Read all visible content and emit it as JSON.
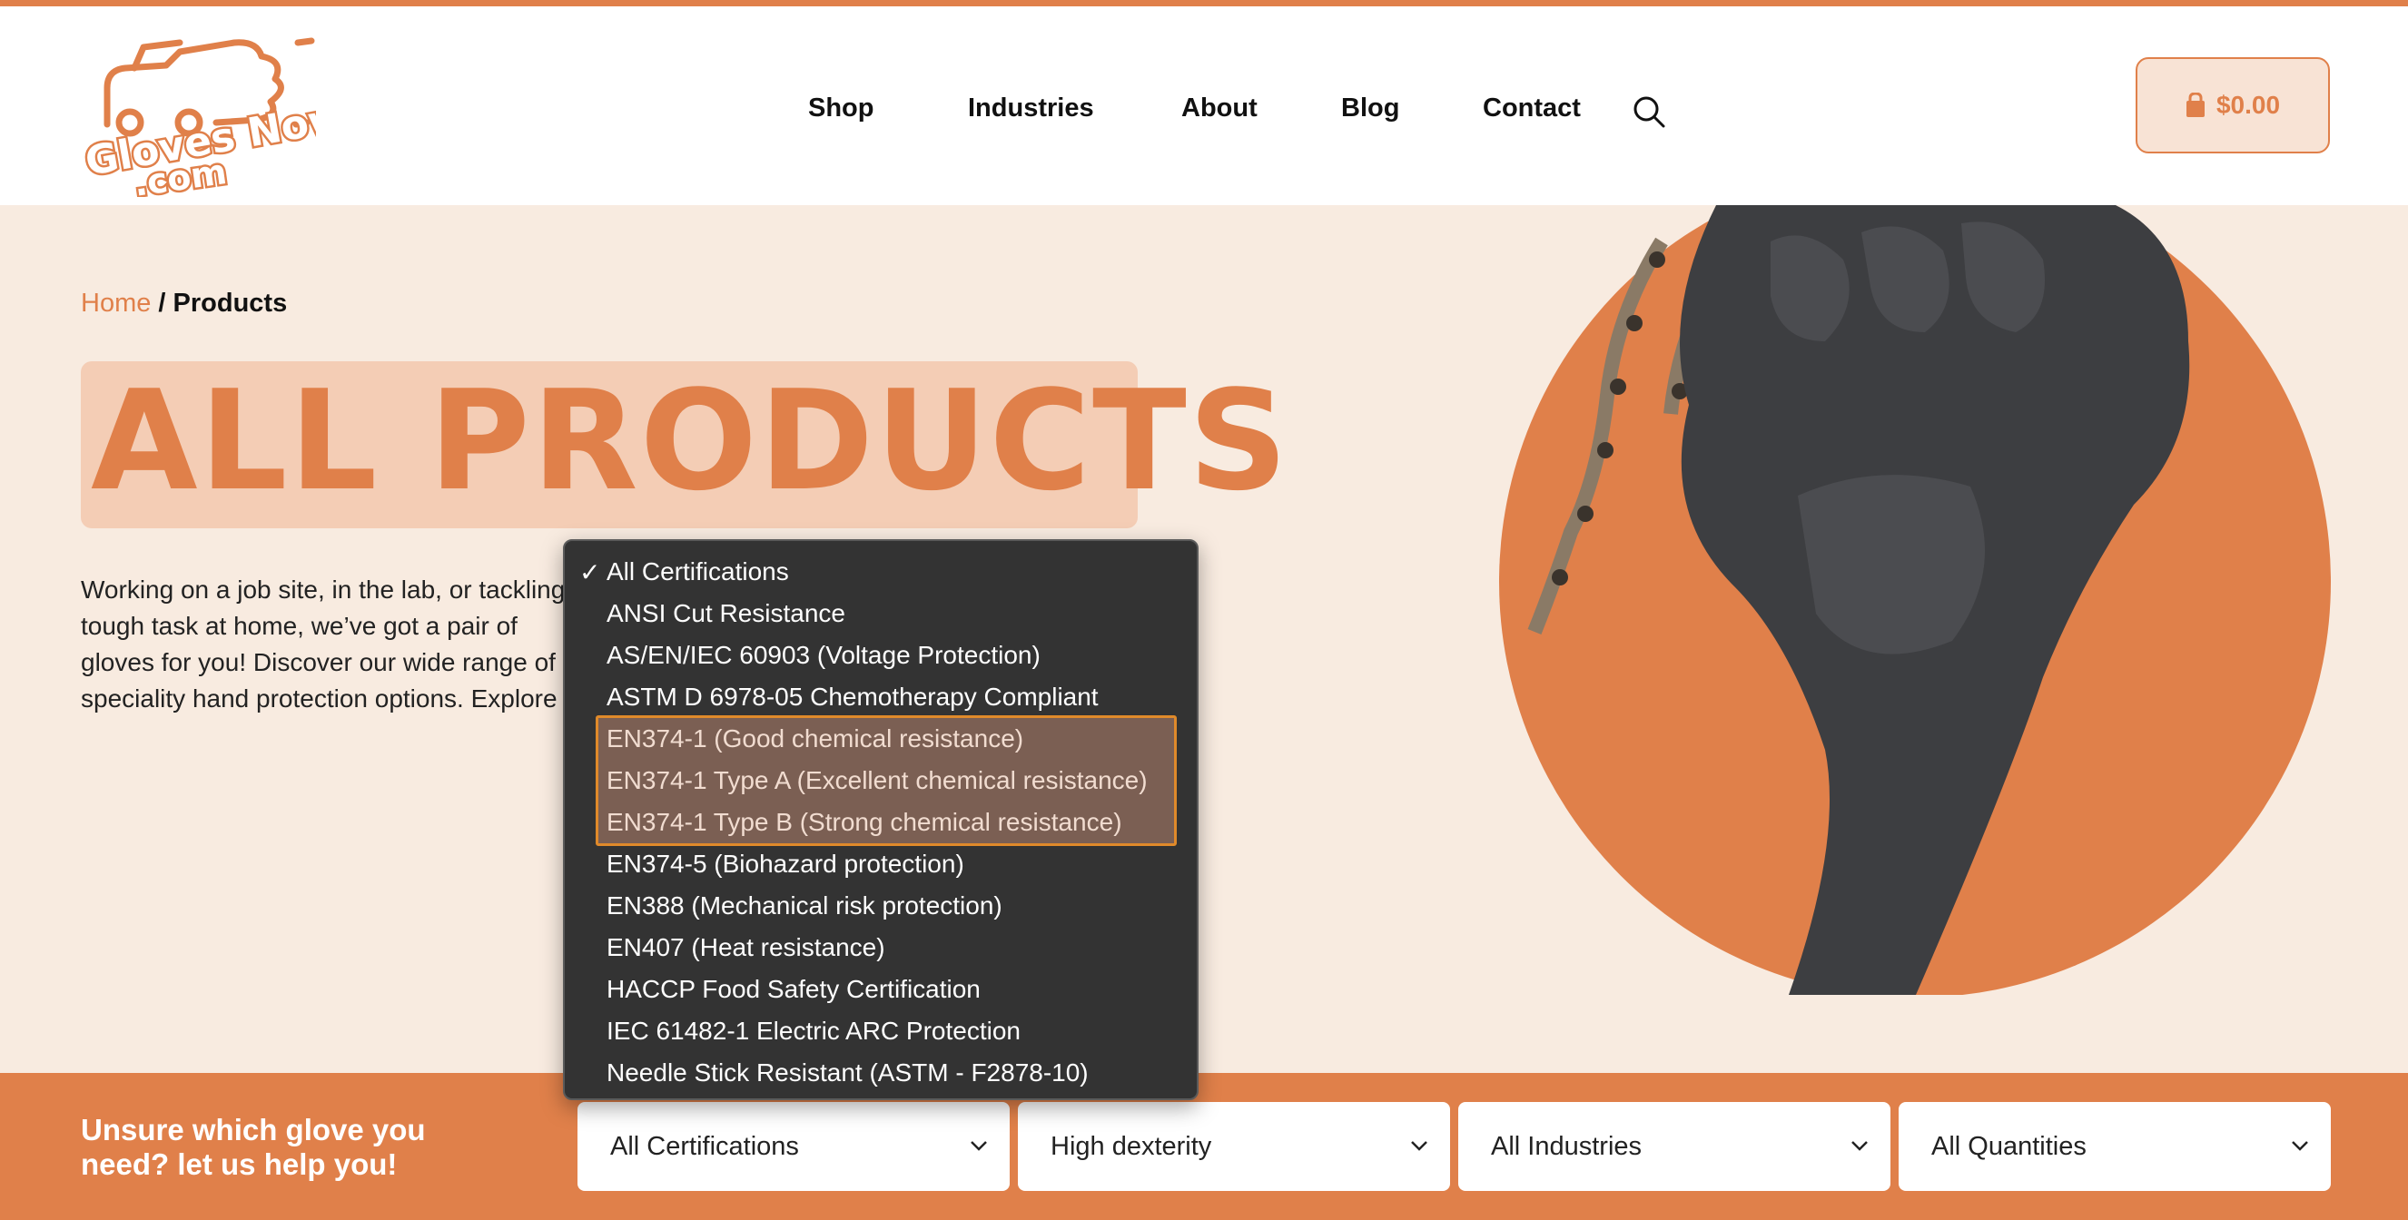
{
  "colors": {
    "accent": "#e0804a",
    "hero_bg": "#f8ebe0",
    "dropdown_bg": "#333333",
    "highlight_border": "#e08a2a"
  },
  "header": {
    "logo_text_1": "Gloves Now",
    "logo_text_2": ".com",
    "nav": [
      "Shop",
      "Industries",
      "About",
      "Blog",
      "Contact"
    ],
    "search_icon": "search-icon",
    "cart_icon": "shopping-bag-icon",
    "cart_total": "$0.00"
  },
  "hero": {
    "breadcrumb_home": "Home",
    "breadcrumb_sep": " / ",
    "breadcrumb_current": "Products",
    "title": "ALL PRODUCTS",
    "intro": "Working on a job site, in the lab, or tackling a tough task at home, we’ve got a pair of gloves for you! Discover our wide range of speciality hand protection options. Explore our selection and find your ideal glove in seconds."
  },
  "certification_dropdown": {
    "selected_check": "✓",
    "options": [
      "All Certifications",
      "ANSI Cut Resistance",
      "AS/EN/IEC 60903 (Voltage Protection)",
      "ASTM D 6978-05 Chemotherapy Compliant",
      "EN374-1 (Good chemical resistance)",
      "EN374-1 Type A (Excellent chemical resistance)",
      "EN374-1 Type B (Strong chemical resistance)",
      "EN374-5 (Biohazard protection)",
      "EN388 (Mechanical risk protection)",
      "EN407 (Heat resistance)",
      "HACCP Food Safety Certification",
      "IEC 61482-1 Electric ARC Protection",
      "Needle Stick Resistant (ASTM - F2878-10)"
    ]
  },
  "filter_bar": {
    "help_text": "Unsure which glove you need? let us help you!",
    "selects": [
      "All Certifications",
      "High dexterity",
      "All Industries",
      "All Quantities"
    ]
  }
}
